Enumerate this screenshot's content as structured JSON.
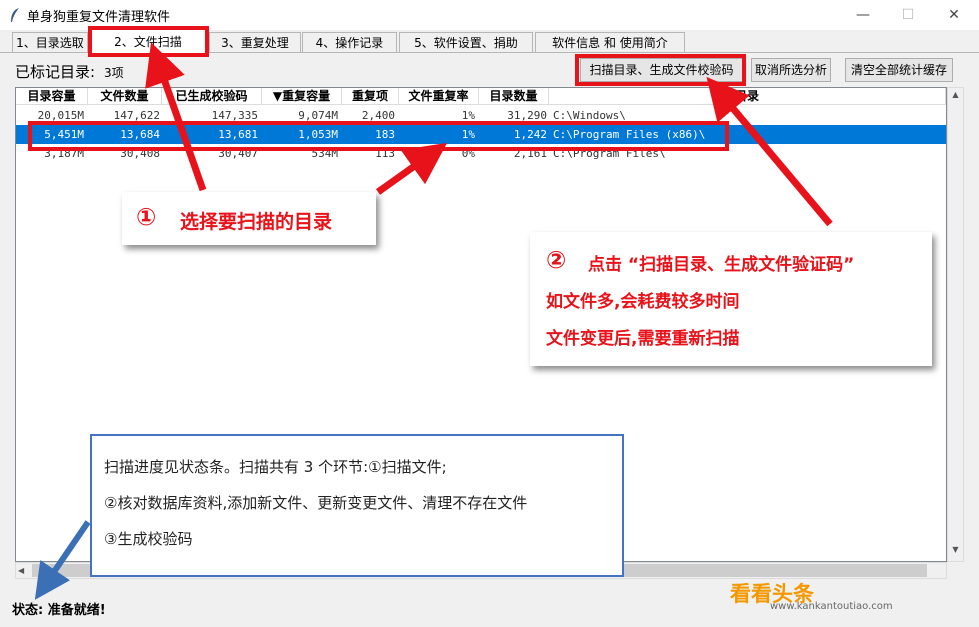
{
  "window": {
    "title": "单身狗重复文件清理软件",
    "minimize": "—",
    "maximize": "☐",
    "close": "✕"
  },
  "tabs": [
    {
      "label": "1、目录选取"
    },
    {
      "label": "2、文件扫描"
    },
    {
      "label": "3、重复处理"
    },
    {
      "label": "4、操作记录"
    },
    {
      "label": "5、软件设置、捐助"
    },
    {
      "label": "软件信息 和 使用简介"
    }
  ],
  "toolbar": {
    "marked_label": "已标记目录:",
    "marked_count": "3项",
    "scan_button": "扫描目录、生成文件校验码",
    "cancel_button": "取消所选分析",
    "clear_button": "清空全部统计缓存"
  },
  "list": {
    "headers": [
      "目录容量",
      "文件数量",
      "已生成校验码",
      "▼重复容量",
      "重复项",
      "文件重复率",
      "目录数量",
      "目录"
    ],
    "rows": [
      [
        "20,015M",
        "147,622",
        "147,335",
        "9,074M",
        "2,400",
        "1%",
        "31,290",
        "C:\\Windows\\"
      ],
      [
        "5,451M",
        "13,684",
        "13,681",
        "1,053M",
        "183",
        "1%",
        "1,242",
        "C:\\Program Files (x86)\\"
      ],
      [
        "3,187M",
        "30,408",
        "30,407",
        "534M",
        "113",
        "0%",
        "2,161",
        "C:\\Program Files\\"
      ]
    ],
    "selected_row": 1
  },
  "scrollbar": {
    "up": "▲",
    "down": "▼",
    "left": "◀"
  },
  "status": {
    "text": "状态: 准备就绪!"
  },
  "annotations": {
    "callout1": {
      "num": "①",
      "text": "选择要扫描的目录"
    },
    "callout2": {
      "num": "②",
      "line1": "点击 “扫描目录、生成文件验证码”",
      "line2": "如文件多,会耗费较多时间",
      "line3": "文件变更后,需要重新扫描"
    },
    "info": {
      "line1": "扫描进度见状态条。扫描共有 3 个环节:①扫描文件;",
      "line2": "②核对数据库资料,添加新文件、更新变更文件、清理不存在文件",
      "line3": "③生成校验码"
    },
    "colors": {
      "red": "#e8131a",
      "blue": "#4472c4",
      "arrow_blue": "#3b6fb6",
      "select": "#0078d7"
    }
  },
  "watermark": {
    "main": "看看头条",
    "sub": "www.kankantoutiao.com"
  }
}
